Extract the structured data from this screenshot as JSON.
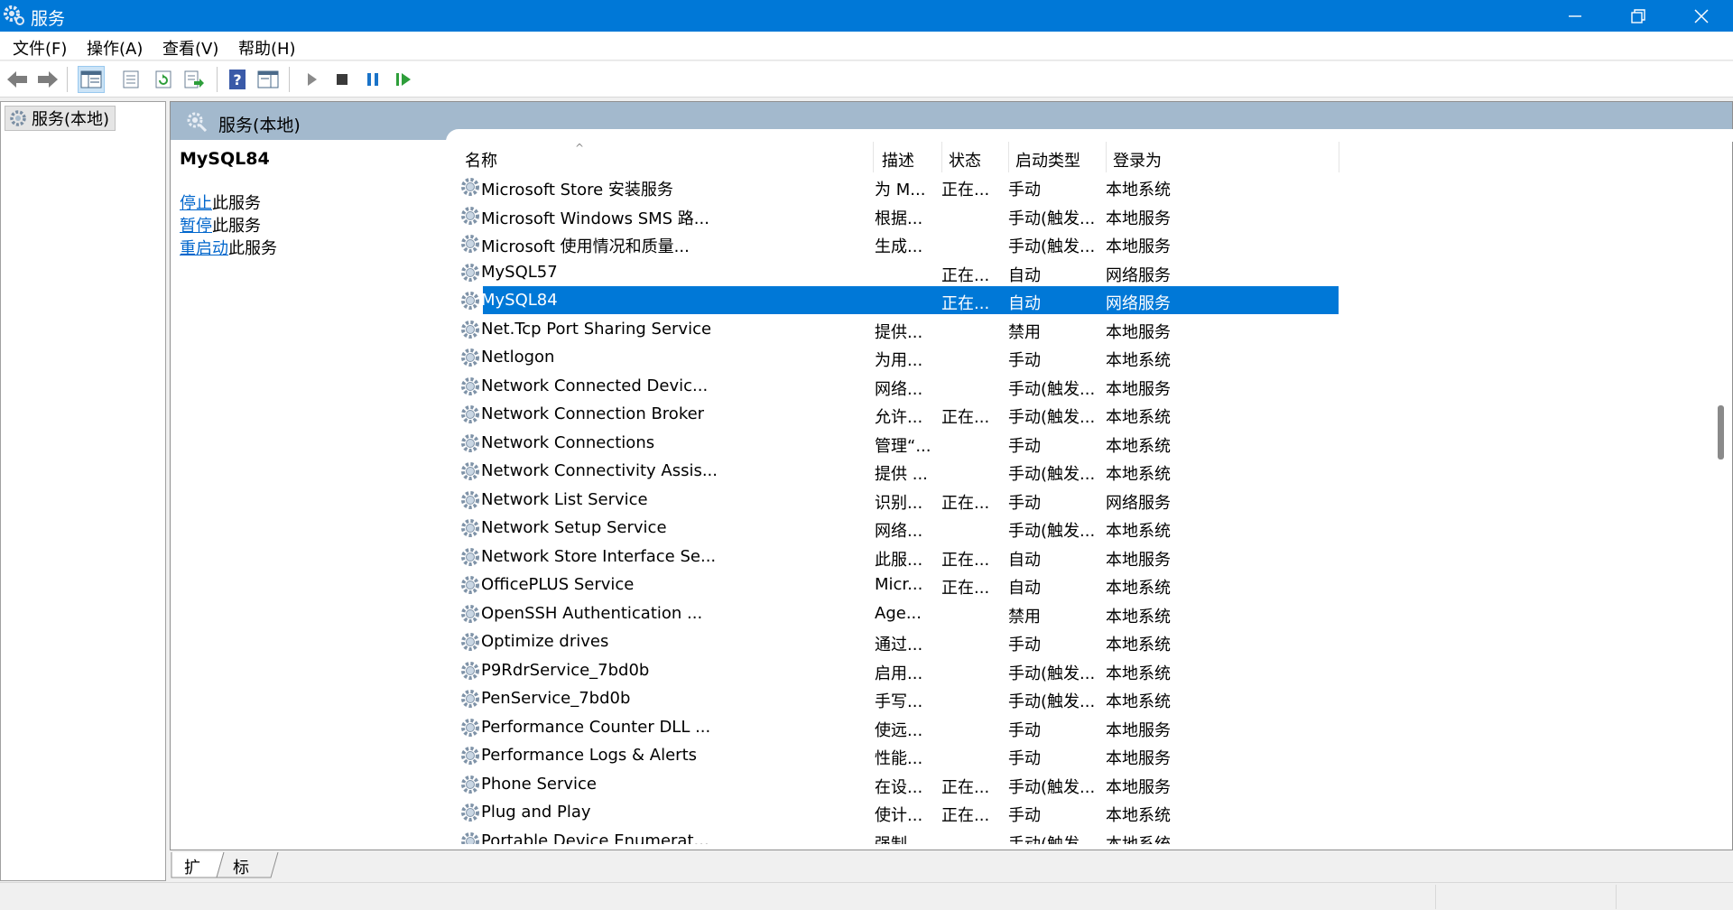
{
  "window": {
    "title": "服务",
    "minimize_icon": "minimize-icon",
    "restore_icon": "restore-icon",
    "close_icon": "close-icon"
  },
  "menu": [
    "文件(F)",
    "操作(A)",
    "查看(V)",
    "帮助(H)"
  ],
  "toolbar": {
    "icons": [
      "back-arrow-icon",
      "forward-arrow-icon",
      "show-console-tree-icon",
      "properties-icon",
      "refresh-icon",
      "export-list-icon",
      "help-icon",
      "show-hide-action-pane-icon",
      "start-service-icon",
      "stop-service-icon",
      "pause-service-icon",
      "resume-service-icon"
    ],
    "active": "show-console-tree-icon"
  },
  "tree": {
    "root_label": "服务(本地)"
  },
  "panel": {
    "header_title": "服务(本地)",
    "selected_service": "MySQL84",
    "actions": [
      {
        "link": "停止",
        "suffix": "此服务"
      },
      {
        "link": "暂停",
        "suffix": "此服务"
      },
      {
        "link": "重启动",
        "suffix": "此服务"
      }
    ]
  },
  "table": {
    "columns": [
      "名称",
      "描述",
      "状态",
      "启动类型",
      "登录为"
    ],
    "selected_index": 4,
    "rows": [
      [
        "Microsoft Store 安装服务",
        "为 M...",
        "正在...",
        "手动",
        "本地系统"
      ],
      [
        "Microsoft Windows SMS 路...",
        "根据...",
        "",
        "手动(触发...",
        "本地服务"
      ],
      [
        "Microsoft 使用情况和质量...",
        "生成...",
        "",
        "手动(触发...",
        "本地服务"
      ],
      [
        "MySQL57",
        "",
        "正在...",
        "自动",
        "网络服务"
      ],
      [
        "MySQL84",
        "",
        "正在...",
        "自动",
        "网络服务"
      ],
      [
        "Net.Tcp Port Sharing Service",
        "提供...",
        "",
        "禁用",
        "本地服务"
      ],
      [
        "Netlogon",
        "为用...",
        "",
        "手动",
        "本地系统"
      ],
      [
        "Network Connected Devic...",
        "网络...",
        "",
        "手动(触发...",
        "本地服务"
      ],
      [
        "Network Connection Broker",
        "允许...",
        "正在...",
        "手动(触发...",
        "本地系统"
      ],
      [
        "Network Connections",
        "管理“...",
        "",
        "手动",
        "本地系统"
      ],
      [
        "Network Connectivity Assis...",
        "提供 ...",
        "",
        "手动(触发...",
        "本地系统"
      ],
      [
        "Network List Service",
        "识别...",
        "正在...",
        "手动",
        "网络服务"
      ],
      [
        "Network Setup Service",
        "网络...",
        "",
        "手动(触发...",
        "本地系统"
      ],
      [
        "Network Store Interface Se...",
        "此服...",
        "正在...",
        "自动",
        "本地服务"
      ],
      [
        "OfficePLUS Service",
        "Micr...",
        "正在...",
        "自动",
        "本地系统"
      ],
      [
        "OpenSSH Authentication ...",
        "Age...",
        "",
        "禁用",
        "本地系统"
      ],
      [
        "Optimize drives",
        "通过...",
        "",
        "手动",
        "本地系统"
      ],
      [
        "P9RdrService_7bd0b",
        "启用...",
        "",
        "手动(触发...",
        "本地系统"
      ],
      [
        "PenService_7bd0b",
        "手写...",
        "",
        "手动(触发...",
        "本地系统"
      ],
      [
        "Performance Counter DLL ...",
        "使远...",
        "",
        "手动",
        "本地服务"
      ],
      [
        "Performance Logs & Alerts",
        "性能...",
        "",
        "手动",
        "本地服务"
      ],
      [
        "Phone Service",
        "在设...",
        "正在...",
        "手动(触发...",
        "本地服务"
      ],
      [
        "Plug and Play",
        "使计...",
        "正在...",
        "手动",
        "本地系统"
      ],
      [
        "Portable Device Enumerat...",
        "强制...",
        "",
        "手动(触发...",
        "本地系统"
      ]
    ]
  },
  "tabs": [
    "扩展",
    "标准"
  ]
}
